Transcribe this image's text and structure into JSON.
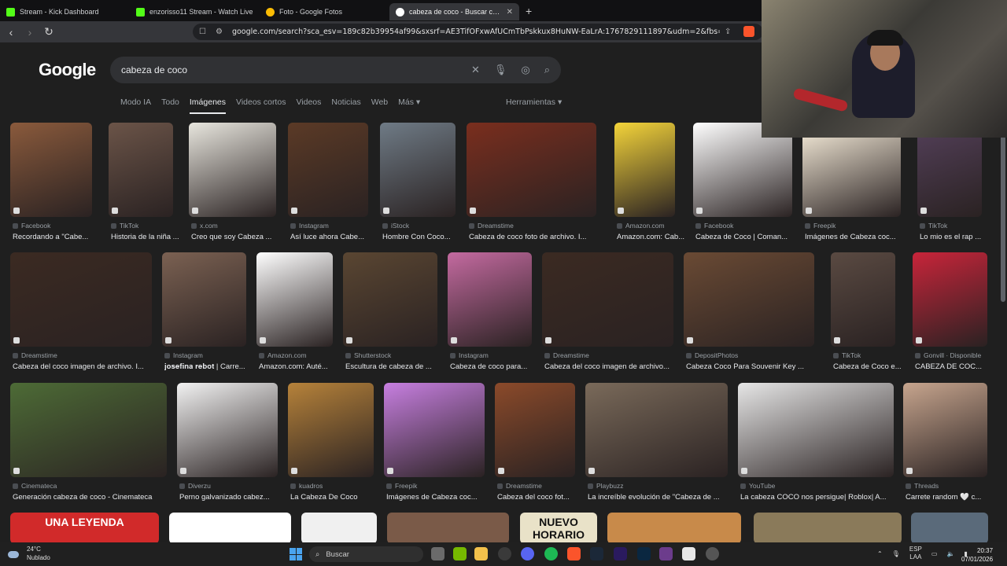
{
  "browser": {
    "tabs": [
      {
        "title": "Stream - Kick Dashboard",
        "color": "#53fc18"
      },
      {
        "title": "enzorisso11 Stream - Watch Live",
        "color": "#53fc18"
      },
      {
        "title": "Foto - Google Fotos",
        "color": "#fbbc04"
      },
      {
        "title": "cabeza de coco - Buscar con Google",
        "color": "#4285f4"
      }
    ],
    "new_tab": "+",
    "url": "google.com/search?sca_esv=189c82b39954af99&sxsrf=AE3TifOFxwAfUCmTbPskkux8HuNW-EaLrA:1767829111897&udm=2&fbs=AIljpHx4nJjfGojPV..."
  },
  "google": {
    "logo": "Google",
    "query": "cabeza de coco",
    "filters": [
      "Modo IA",
      "Todo",
      "Imágenes",
      "Videos cortos",
      "Videos",
      "Noticias",
      "Web",
      "Más ▾"
    ],
    "selected_filter": "Imágenes",
    "tools": "Herramientas ▾"
  },
  "results": [
    {
      "source": "Facebook",
      "title": "Recordando a \"Cabe...",
      "color": "#8a5a3c",
      "w": 1
    },
    {
      "source": "TikTok",
      "title": "Historia de la niña ...",
      "color": "#6b5448",
      "w": 1
    },
    {
      "source": "x.com",
      "title": "Creo que soy Cabeza ...",
      "color": "#e8e6de",
      "w": 1
    },
    {
      "source": "Instagram",
      "title": "Así luce ahora Cabe...",
      "color": "#5b3a26",
      "w": 1
    },
    {
      "source": "iStock",
      "title": "Hombre Con Coco...",
      "color": "#6f7b86",
      "w": 1
    },
    {
      "source": "Dreamstime",
      "title": "Cabeza de coco foto de archivo. I...",
      "color": "#7a2e1e",
      "w": 1
    },
    {
      "source": "Amazon.com",
      "title": "Amazon.com: Cab...",
      "color": "#f4d43a",
      "w": 1
    },
    {
      "source": "Facebook",
      "title": "Cabeza de Coco | Coman...",
      "color": "#ffffff",
      "w": 1
    },
    {
      "source": "Freepik",
      "title": "Imágenes de Cabeza coc...",
      "color": "#fdf3e0",
      "w": 1
    },
    {
      "source": "TikTok",
      "title": "Lo mio es el rap ...",
      "color": "#54405a",
      "w": 1
    },
    {
      "source": "Dreamstime",
      "title": "Cabeza del coco imagen de archivo. I...",
      "color": "#3b2a22",
      "w": 1
    },
    {
      "source": "Instagram",
      "title": "𝐣𝐨𝐬𝐞𝐟𝐢𝐧𝐚 𝐫𝐞𝐛𝐨𝐭 | Carre...",
      "color": "#7b6152",
      "w": 1
    },
    {
      "source": "Amazon.com",
      "title": "Amazon.com: Auté...",
      "color": "#ffffff",
      "w": 1
    },
    {
      "source": "Shutterstock",
      "title": "Escultura de cabeza de ...",
      "color": "#5a4632",
      "w": 1
    },
    {
      "source": "Instagram",
      "title": "Cabeza de coco para...",
      "color": "#c46aa0",
      "w": 1
    },
    {
      "source": "Dreamstime",
      "title": "Cabeza del coco imagen de archivo...",
      "color": "#3b2a22",
      "w": 1
    },
    {
      "source": "DepositPhotos",
      "title": "Cabeza Coco Para Souvenir Key ...",
      "color": "#6a4a34",
      "w": 1
    },
    {
      "source": "TikTok",
      "title": "Cabeza de Coco e...",
      "color": "#5a4a42",
      "w": 1
    },
    {
      "source": "Gonvill · Disponible",
      "title": "CABEZA DE COC...",
      "color": "#c8243a",
      "w": 1
    },
    {
      "source": "Cinemateca",
      "title": "Generación cabeza de coco - Cinemateca",
      "color": "#4d6b36",
      "w": 1
    },
    {
      "source": "Diverzu",
      "title": "Perno galvanizado cabez...",
      "color": "#f2f2f2",
      "w": 1
    },
    {
      "source": "kuadros",
      "title": "La Cabeza De Coco",
      "color": "#b6823a",
      "w": 1
    },
    {
      "source": "Freepik",
      "title": "Imágenes de Cabeza coc...",
      "color": "#c77fe0",
      "w": 1
    },
    {
      "source": "Dreamstime",
      "title": "Cabeza del coco fot...",
      "color": "#8b4a2a",
      "w": 1
    },
    {
      "source": "Playbuzz",
      "title": "La increíble evolución de \"Cabeza de ...",
      "color": "#7a6a5a",
      "w": 1
    },
    {
      "source": "YouTube",
      "title": "La cabeza COCO nos persigue| Roblox| A...",
      "color": "#e6e6e6",
      "w": 1
    },
    {
      "source": "Threads",
      "title": "Carrete random 🤍 c...",
      "color": "#c7a58e",
      "w": 1
    }
  ],
  "bottom_row_text": [
    "UNA LEYENDA",
    "NUEVO HORARIO"
  ],
  "taskbar": {
    "weather_temp": "24°C",
    "weather_desc": "Nublado",
    "search": "Buscar",
    "lang1": "ESP",
    "lang2": "LAA",
    "time": "20:37",
    "date": "07/01/2026"
  }
}
